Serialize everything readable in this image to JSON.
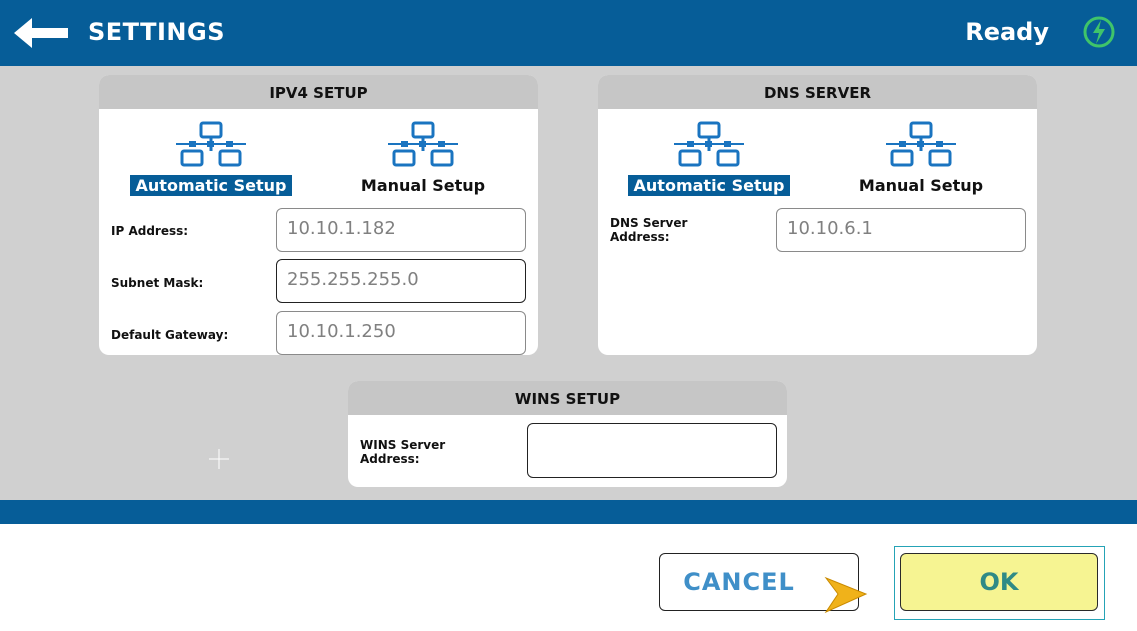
{
  "header": {
    "title": "SETTINGS",
    "status": "Ready",
    "back_icon": "left-arrow-icon",
    "status_icon": "power-status-icon",
    "color": "#065d98"
  },
  "ipv4": {
    "title": "IPV4 SETUP",
    "options": [
      {
        "label": "Automatic Setup",
        "selected": true,
        "icon": "network-icon"
      },
      {
        "label": "Manual Setup",
        "selected": false,
        "icon": "network-icon"
      }
    ],
    "fields": {
      "ip_label": "IP Address:",
      "ip_value": "10.10.1.182",
      "subnet_label": "Subnet Mask:",
      "subnet_value": "255.255.255.0",
      "gateway_label": "Default Gateway:",
      "gateway_value": "10.10.1.250"
    }
  },
  "dns": {
    "title": "DNS SERVER",
    "options": [
      {
        "label": "Automatic Setup",
        "selected": true,
        "icon": "network-icon"
      },
      {
        "label": "Manual Setup",
        "selected": false,
        "icon": "network-icon"
      }
    ],
    "field_label_line1": "DNS Server",
    "field_label_line2": "Address:",
    "field_value": "10.10.6.1"
  },
  "wins": {
    "title": "WINS SETUP",
    "field_label_line1": "WINS Server",
    "field_label_line2": "Address:",
    "field_value": ""
  },
  "buttons": {
    "cancel": "CANCEL",
    "ok": "OK"
  },
  "colors": {
    "accent": "#065d98",
    "ok_bg": "#f6f492",
    "cancel_text": "#3f8fc8",
    "ok_text": "#2f8a86"
  }
}
